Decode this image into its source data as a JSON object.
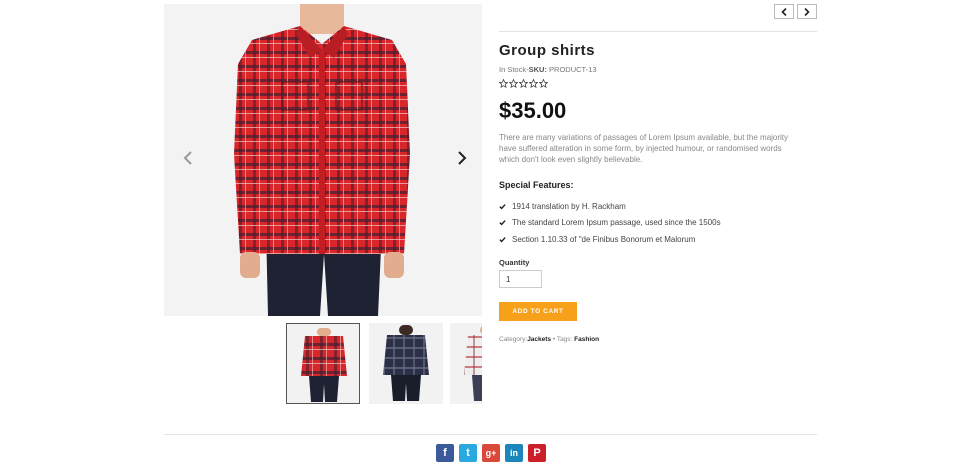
{
  "product": {
    "title": "Group shirts",
    "stock_status": "In Stock",
    "sku_label": "SKU:",
    "sku_value": "PRODUCT-13",
    "rating": 0,
    "rating_max": 5,
    "price": "$35.00",
    "description": "There are many variations of passages of Lorem Ipsum available, but the majority have suffered alteration in some form, by injected humour, or randomised words which don't look even slightly believable.",
    "features_title": "Special Features:",
    "features": [
      "1914 translation by H. Rackham",
      "The standard Lorem Ipsum passage, used since the 1500s",
      "Section 1.10.33 of \"de Finibus Bonorum et Malorum"
    ],
    "quantity_label": "Quantity",
    "quantity_value": "1",
    "add_to_cart_label": "ADD TO CART",
    "category_label": "Category:",
    "category": "Jackets",
    "tags_separator": " • Tags: ",
    "tag": "Fashion"
  },
  "gallery": {
    "thumbnails": [
      "red-plaid-shirt",
      "navy-plaid-shirt",
      "white-red-plaid-shirt"
    ],
    "active_index": 0
  },
  "icons": {
    "prev": "chevron-left-icon",
    "next": "chevron-right-icon",
    "check": "check-icon",
    "star": "star-outline-icon"
  },
  "social": {
    "facebook": "f",
    "twitter": "t",
    "googleplus": "g+",
    "linkedin": "in",
    "pinterest": "P"
  },
  "colors": {
    "accent": "#f7a11a",
    "facebook": "#3b5a9a",
    "twitter": "#2aa9e0",
    "googleplus": "#d9493a",
    "linkedin": "#1b86bc",
    "pinterest": "#cb2028"
  }
}
